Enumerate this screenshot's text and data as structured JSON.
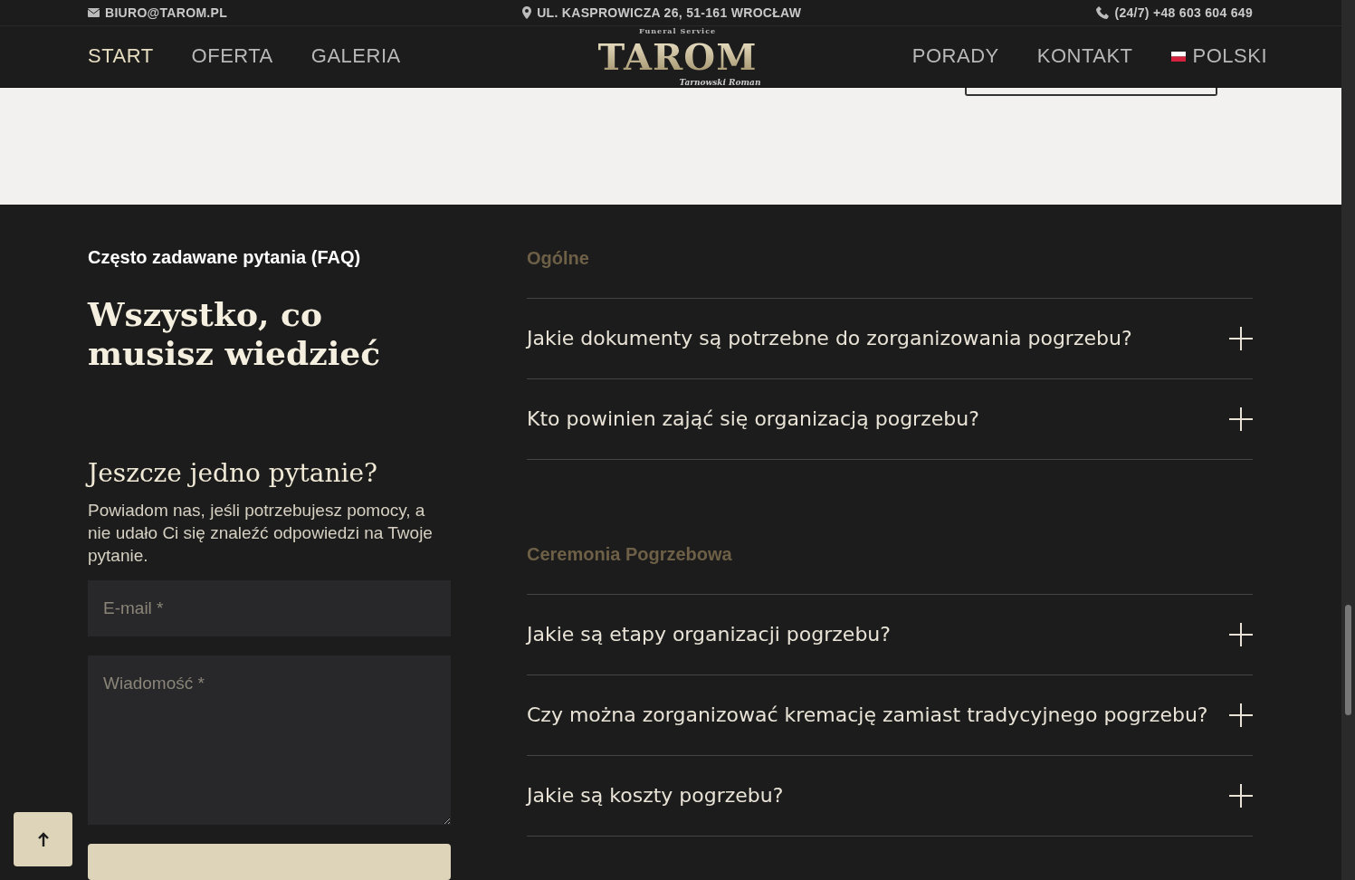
{
  "topbar": {
    "email": "BIURO@TAROM.PL",
    "address": "UL. KASPROWICZA 26, 51-161 WROCŁAW",
    "phone": "(24/7) +48 603 604 649"
  },
  "nav": {
    "left": [
      {
        "label": "START",
        "selected": true
      },
      {
        "label": "OFERTA",
        "selected": false
      },
      {
        "label": "GALERIA",
        "selected": false
      }
    ],
    "logo": {
      "tagline": "Funeral Service",
      "name": "TAROM",
      "owner": "Tarnowski Roman"
    },
    "right": [
      {
        "label": "PORADY",
        "selected": false
      },
      {
        "label": "KONTAKT",
        "selected": false
      }
    ],
    "language": {
      "label": "POLSKI"
    }
  },
  "faq": {
    "eyebrow": "Często zadawane pytania (FAQ)",
    "heading": "Wszystko, co musisz wiedzieć",
    "contact": {
      "heading": "Jeszcze jedno pytanie?",
      "text": "Powiadom nas, jeśli potrzebujesz pomocy, a nie udało Ci się znaleźć odpowiedzi na Twoje pytanie.",
      "email_placeholder": "E-mail *",
      "message_placeholder": "Wiadomość *"
    },
    "groups": [
      {
        "title": "Ogólne",
        "questions": [
          {
            "question": "Jakie dokumenty są potrzebne do zorganizowania pogrzebu?",
            "expanded": false
          },
          {
            "question": "Kto powinien zająć się organizacją pogrzebu?",
            "expanded": false
          }
        ]
      },
      {
        "title": "Ceremonia Pogrzebowa",
        "questions": [
          {
            "question": "Jakie są etapy organizacji pogrzebu?",
            "expanded": false
          },
          {
            "question": "Czy można zorganizować kremację zamiast tradycyjnego pogrzebu?",
            "expanded": false
          },
          {
            "question": "Jakie są koszty pogrzebu?",
            "expanded": false
          }
        ]
      }
    ]
  }
}
